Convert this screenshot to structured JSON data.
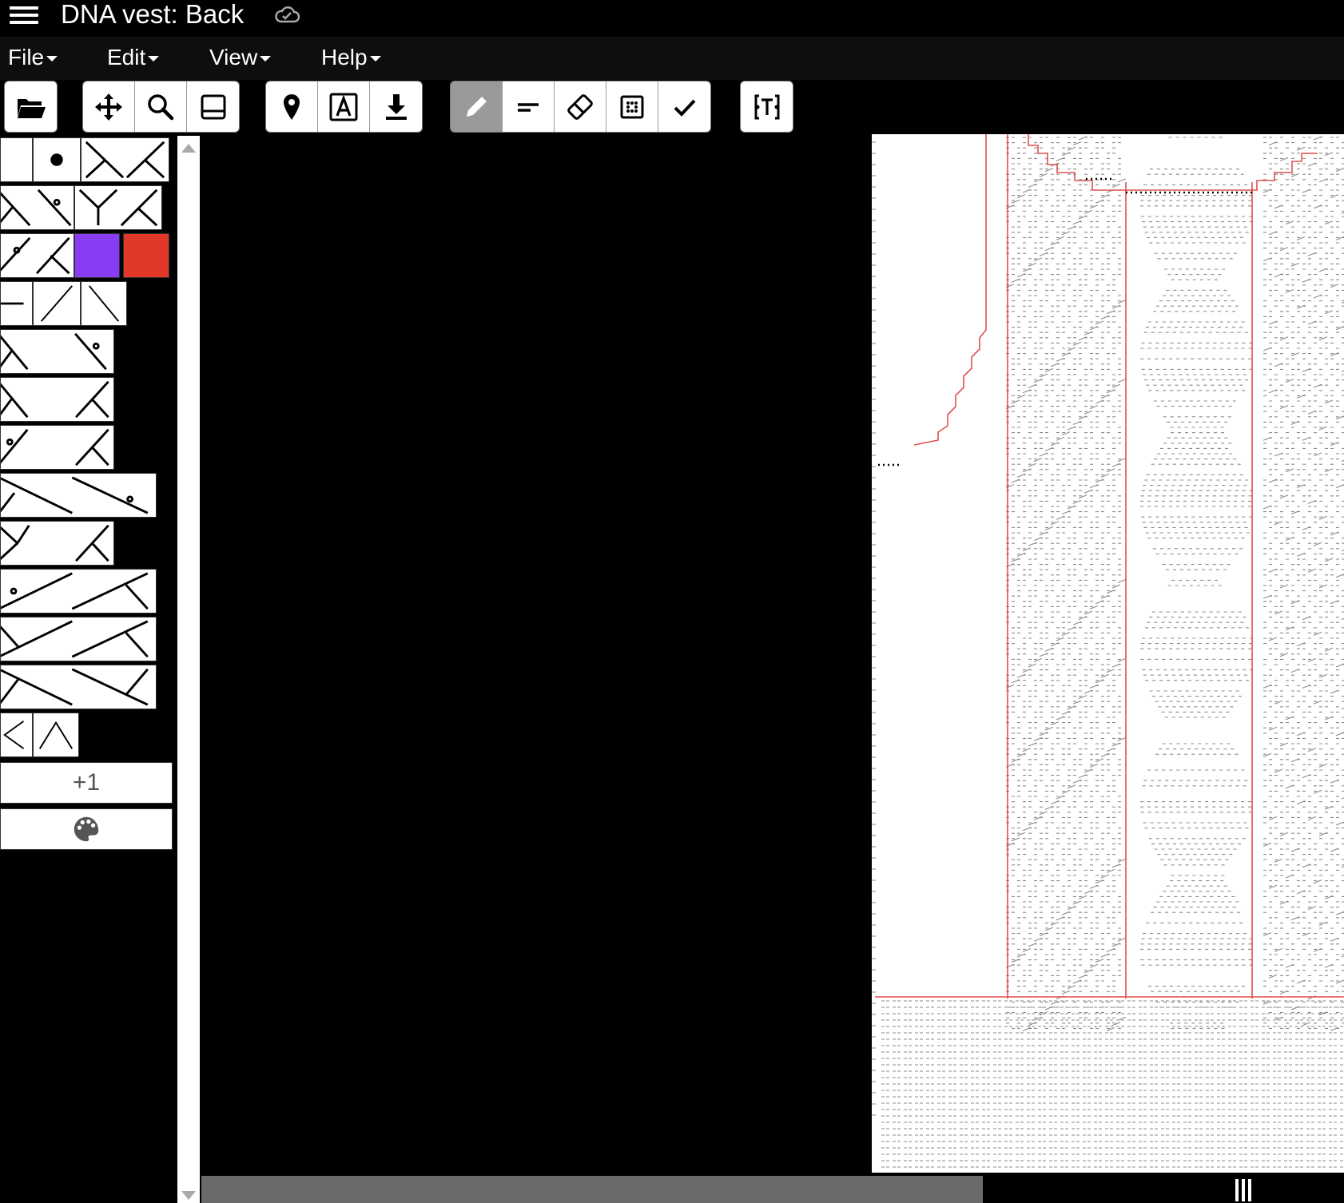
{
  "app": {
    "title": "DNA vest: Back",
    "sync_icon": "cloud-sync-icon",
    "menu_icon": "hamburger-menu-icon"
  },
  "menus": [
    "File",
    "Edit",
    "View",
    "Help"
  ],
  "toolbar": {
    "groups": [
      [
        "folder-open-icon"
      ],
      [
        "move-arrows-icon",
        "search-icon",
        "panel-icon"
      ],
      [
        "map-pin-icon",
        "letter-a-icon",
        "download-icon"
      ],
      [
        "pencil-icon",
        "line-tool-icon",
        "eraser-icon",
        "grid-select-icon",
        "check-icon"
      ],
      [
        "text-box-icon"
      ]
    ],
    "active_tool": "pencil-icon"
  },
  "palette": {
    "swatches": [
      "#8a3cf5",
      "#e2382a"
    ],
    "add_button_label": "+1",
    "color_button_icon": "palette-icon"
  },
  "colors": {
    "outline": "#e05050",
    "background": "#000000",
    "accent_purple": "#8a3cf5",
    "accent_red": "#e2382a"
  }
}
